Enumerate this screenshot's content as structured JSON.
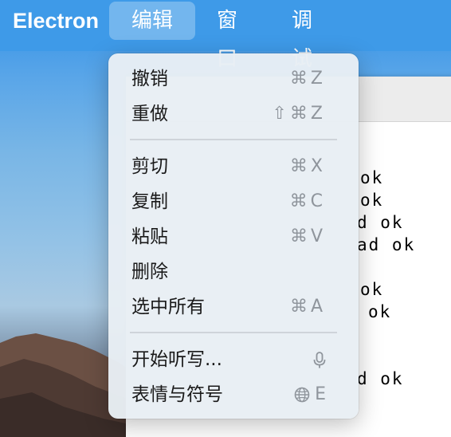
{
  "menubar": {
    "app_name": "Electron",
    "menus": [
      "编辑",
      "窗口",
      "调试"
    ]
  },
  "edit_menu": {
    "items": [
      {
        "label": "撤销",
        "shortcut": "⌘Z"
      },
      {
        "label": "重做",
        "shortcut": "⇧⌘Z"
      },
      {
        "label": "剪切",
        "shortcut": "⌘X"
      },
      {
        "label": "复制",
        "shortcut": "⌘C"
      },
      {
        "label": "粘贴",
        "shortcut": "⌘V"
      },
      {
        "label": "删除",
        "shortcut": ""
      },
      {
        "label": "选中所有",
        "shortcut": "⌘A"
      },
      {
        "label": "开始听写...",
        "shortcut_icon": "microphone-icon"
      },
      {
        "label": "表情与符号",
        "shortcut_icon": "globe-icon",
        "shortcut_key": "E"
      }
    ]
  },
  "app_log": {
    "lines": [
      "ok",
      "ok",
      "d ok",
      "ad ok",
      "ok",
      "ok",
      "d ok"
    ]
  },
  "colors": {
    "menubar": "#3e9ae8",
    "menu_background": "#e8eef4",
    "shortcut_gray": "#8f959c"
  }
}
